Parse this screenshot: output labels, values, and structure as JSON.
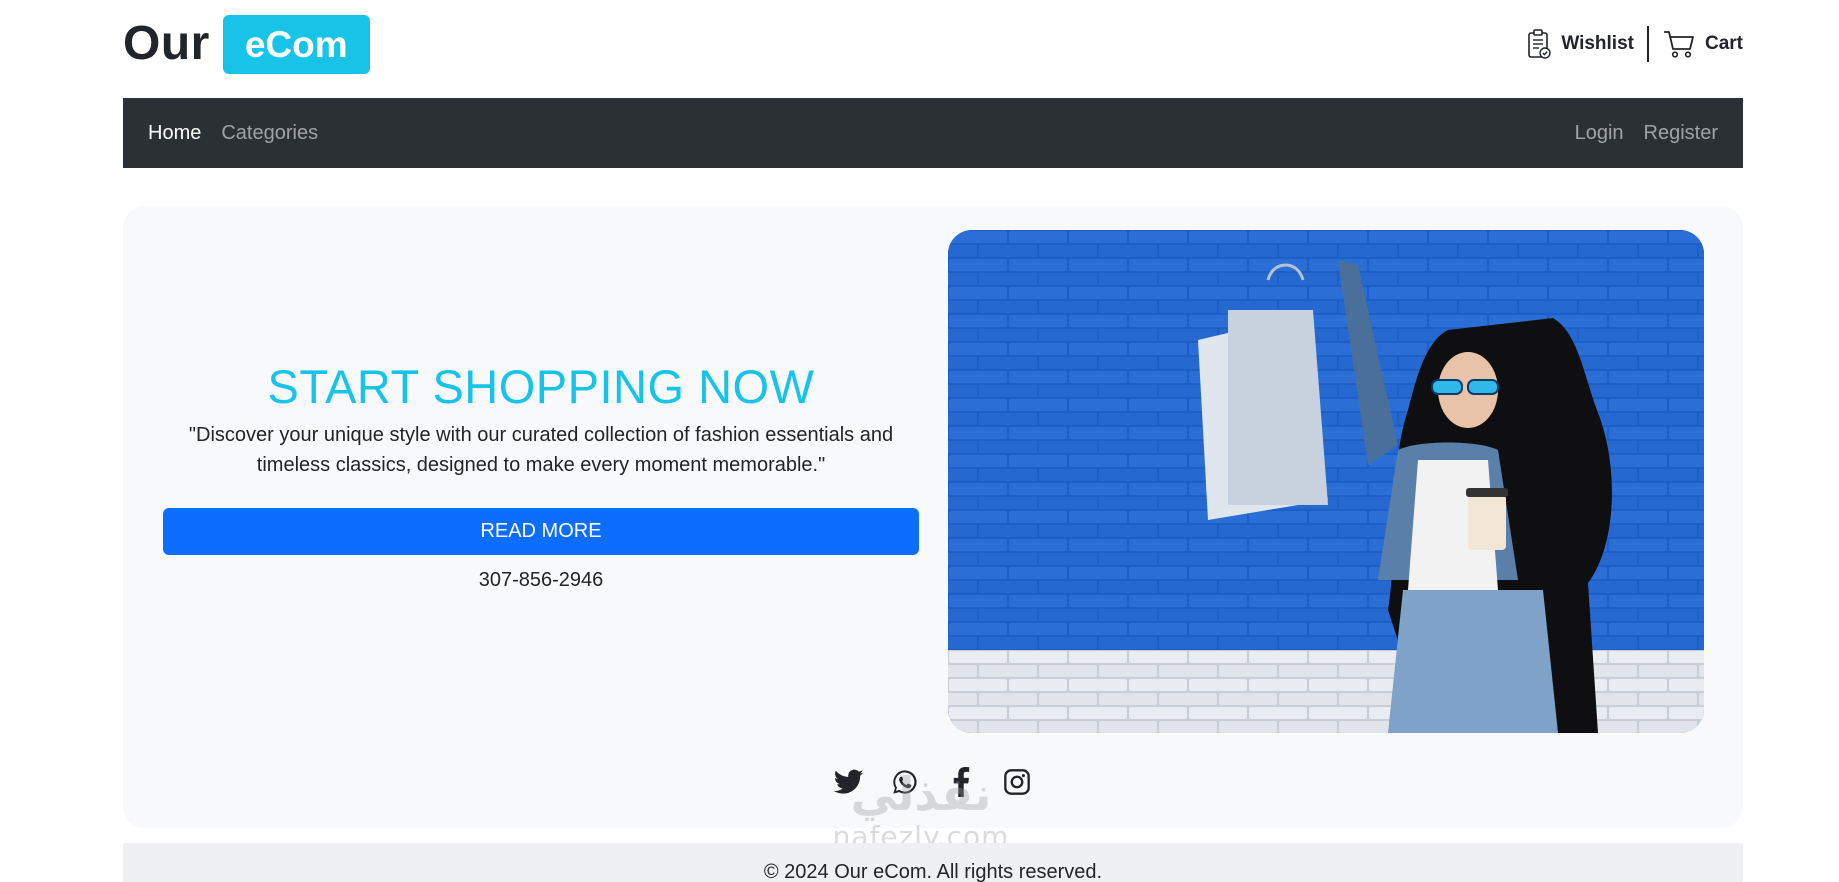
{
  "header": {
    "brand_our": "Our",
    "brand_badge": "eCom",
    "wishlist_label": "Wishlist",
    "cart_label": "Cart"
  },
  "navbar": {
    "left": [
      {
        "label": "Home",
        "active": true
      },
      {
        "label": "Categories",
        "active": false
      }
    ],
    "right": [
      {
        "label": "Login"
      },
      {
        "label": "Register"
      }
    ]
  },
  "hero": {
    "title": "START SHOPPING NOW",
    "description": "\"Discover your unique style with our curated collection of fashion essentials and timeless classics, designed to make every moment memorable.\"",
    "button_label": "READ MORE",
    "phone": "307-856-2946"
  },
  "socials": [
    "twitter-icon",
    "whatsapp-icon",
    "facebook-icon",
    "instagram-icon"
  ],
  "watermark": {
    "arabic": "نفذلي",
    "latin": "nafezly.com"
  },
  "footer": {
    "copyright": "© 2024 Our eCom. All rights reserved."
  },
  "colors": {
    "accent": "#17c4e8",
    "primary_button": "#0d6efd",
    "navbar_bg": "#2b3035",
    "hero_bg": "#f8f9fa"
  }
}
